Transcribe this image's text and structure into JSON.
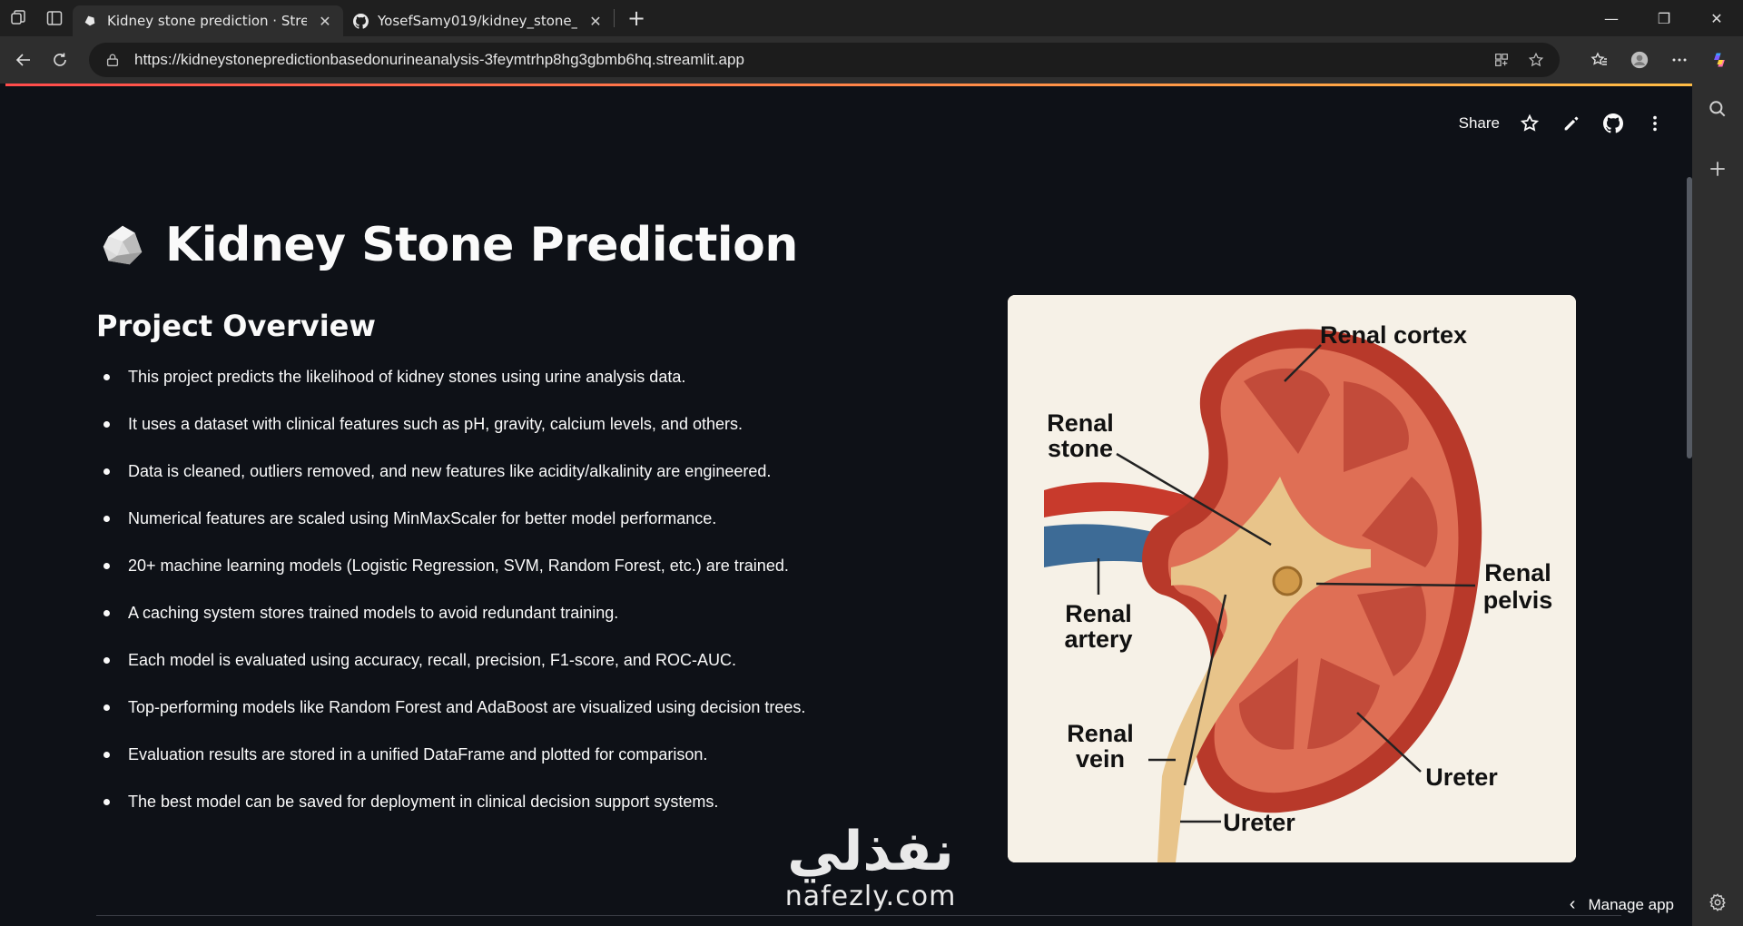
{
  "browser": {
    "tabs": [
      {
        "title": "Kidney stone prediction · Streamlit",
        "active": true
      },
      {
        "title": "YosefSamy019/kidney_stone_prediction",
        "active": false
      }
    ],
    "url": "https://kidneystonepredictionbasedonurineanalysis-3feymtrhp8hg3gbmb6hq.streamlit.app"
  },
  "app_header": {
    "share_label": "Share"
  },
  "page": {
    "title": "Kidney Stone Prediction",
    "overview_heading": "Project Overview",
    "bullets": [
      "This project predicts the likelihood of kidney stones using urine analysis data.",
      "It uses a dataset with clinical features such as pH, gravity, calcium levels, and others.",
      "Data is cleaned, outliers removed, and new features like acidity/alkalinity are engineered.",
      "Numerical features are scaled using MinMaxScaler for better model performance.",
      "20+ machine learning models (Logistic Regression, SVM, Random Forest, etc.) are trained.",
      "A caching system stores trained models to avoid redundant training.",
      "Each model is evaluated using accuracy, recall, precision, F1-score, and ROC-AUC.",
      "Top-performing models like Random Forest and AdaBoost are visualized using decision trees.",
      "Evaluation results are stored in a unified DataFrame and plotted for comparison.",
      "The best model can be saved for deployment in clinical decision support systems."
    ]
  },
  "kidney_image": {
    "labels": {
      "renal_cortex": "Renal cortex",
      "renal_stone_1": "Renal",
      "renal_stone_2": "stone",
      "renal_pelvis_1": "Renal",
      "renal_pelvis_2": "pelvis",
      "renal_artery_1": "Renal",
      "renal_artery_2": "artery",
      "renal_vein_1": "Renal",
      "renal_vein_2": "vein",
      "ureter_right": "Ureter",
      "ureter_bottom": "Ureter"
    }
  },
  "watermark": {
    "arabic": "نفذلي",
    "latin": "nafezly.com"
  },
  "footer": {
    "manage_app_label": "Manage app"
  },
  "colors": {
    "app_bg": "#0e1117",
    "accent_start": "#ff4b4b",
    "accent_end": "#ffbd45"
  }
}
